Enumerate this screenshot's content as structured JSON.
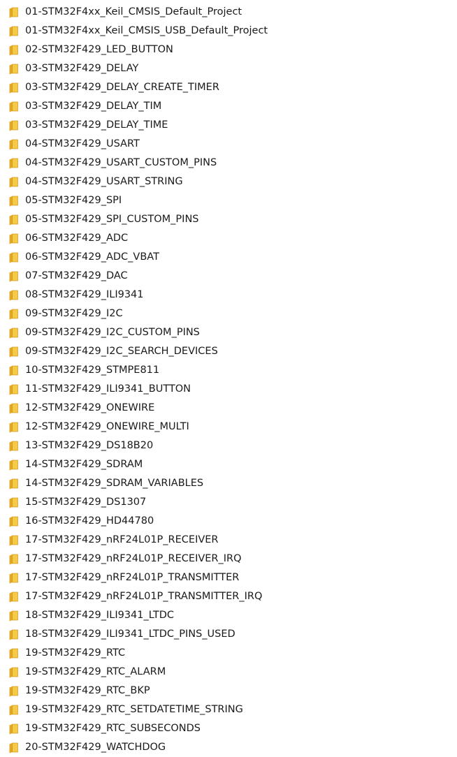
{
  "folder_list": {
    "icon": "folder-icon",
    "colors": {
      "folder_front": "#f7c948",
      "folder_back": "#e3a823",
      "folder_edge": "#c98d10",
      "text": "#1a1a1a"
    },
    "items": [
      "01-STM32F4xx_Keil_CMSIS_Default_Project",
      "01-STM32F4xx_Keil_CMSIS_USB_Default_Project",
      "02-STM32F429_LED_BUTTON",
      "03-STM32F429_DELAY",
      "03-STM32F429_DELAY_CREATE_TIMER",
      "03-STM32F429_DELAY_TIM",
      "03-STM32F429_DELAY_TIME",
      "04-STM32F429_USART",
      "04-STM32F429_USART_CUSTOM_PINS",
      "04-STM32F429_USART_STRING",
      "05-STM32F429_SPI",
      "05-STM32F429_SPI_CUSTOM_PINS",
      "06-STM32F429_ADC",
      "06-STM32F429_ADC_VBAT",
      "07-STM32F429_DAC",
      "08-STM32F429_ILI9341",
      "09-STM32F429_I2C",
      "09-STM32F429_I2C_CUSTOM_PINS",
      "09-STM32F429_I2C_SEARCH_DEVICES",
      "10-STM32F429_STMPE811",
      "11-STM32F429_ILI9341_BUTTON",
      "12-STM32F429_ONEWIRE",
      "12-STM32F429_ONEWIRE_MULTI",
      "13-STM32F429_DS18B20",
      "14-STM32F429_SDRAM",
      "14-STM32F429_SDRAM_VARIABLES",
      "15-STM32F429_DS1307",
      "16-STM32F429_HD44780",
      "17-STM32F429_nRF24L01P_RECEIVER",
      "17-STM32F429_nRF24L01P_RECEIVER_IRQ",
      "17-STM32F429_nRF24L01P_TRANSMITTER",
      "17-STM32F429_nRF24L01P_TRANSMITTER_IRQ",
      "18-STM32F429_ILI9341_LTDC",
      "18-STM32F429_ILI9341_LTDC_PINS_USED",
      "19-STM32F429_RTC",
      "19-STM32F429_RTC_ALARM",
      "19-STM32F429_RTC_BKP",
      "19-STM32F429_RTC_SETDATETIME_STRING",
      "19-STM32F429_RTC_SUBSECONDS",
      "20-STM32F429_WATCHDOG"
    ]
  }
}
